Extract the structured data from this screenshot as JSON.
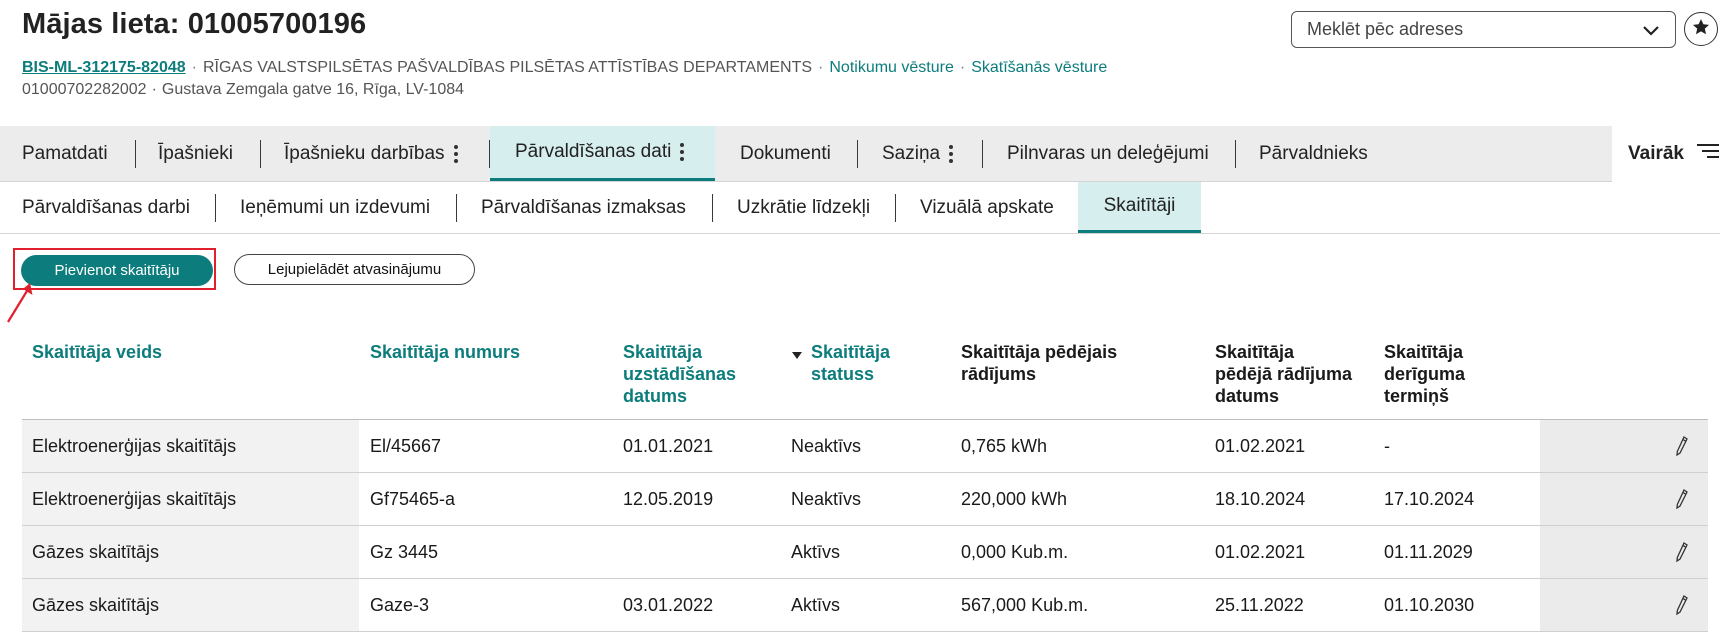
{
  "header": {
    "title": "Mājas lieta: 01005700196",
    "case_code": "BIS-ML-312175-82048",
    "department": "RĪGAS VALSTSPILSĒTAS PAŠVALDĪBAS PILSĒTAS ATTĪSTĪBAS DEPARTAMENTS",
    "separator": "·",
    "event_history_link": "Notikumu vēsture",
    "view_history_link": "Skatīšanās vēsture",
    "cadastre_number": "01000702282002",
    "address": "Gustava Zemgala gatve 16, Rīga, LV-1084"
  },
  "search": {
    "placeholder": "Meklēt pēc adreses",
    "icon": "chevron-down-icon"
  },
  "favorite_icon": "star-icon",
  "main_tabs": [
    {
      "label": "Pamatdati",
      "has_menu": false
    },
    {
      "label": "Īpašnieki",
      "has_menu": false
    },
    {
      "label": "Īpašnieku darbības",
      "has_menu": true
    },
    {
      "label": "Pārvaldīšanas dati",
      "has_menu": true,
      "active": true
    },
    {
      "label": "Dokumenti",
      "has_menu": false
    },
    {
      "label": "Saziņa",
      "has_menu": true
    },
    {
      "label": "Pilnvaras un deleģējumi",
      "has_menu": false
    },
    {
      "label": "Pārvaldnieks",
      "has_menu": false
    }
  ],
  "more_label": "Vairāk",
  "sub_tabs": [
    {
      "label": "Pārvaldīšanas darbi"
    },
    {
      "label": "Ieņēmumi un izdevumi"
    },
    {
      "label": "Pārvaldīšanas izmaksas"
    },
    {
      "label": "Uzkrātie līdzekļi"
    },
    {
      "label": "Vizuālā apskate"
    },
    {
      "label": "Skaitītāji",
      "active": true
    }
  ],
  "actions": {
    "add_meter": "Pievienot skaitītāju",
    "download_report": "Lejupielādēt atvasinājumu"
  },
  "table": {
    "columns": [
      {
        "l1": "Skaitītāja veids",
        "l2": "",
        "l3": ""
      },
      {
        "l1": "Skaitītāja numurs",
        "l2": "",
        "l3": ""
      },
      {
        "l1": "Skaitītāja",
        "l2": "uzstādīšanas",
        "l3": "datums"
      },
      {
        "l1": "Skaitītāja",
        "l2": "statuss",
        "l3": ""
      },
      {
        "l1": "Skaitītāja pēdējais",
        "l2": "rādījums",
        "l3": ""
      },
      {
        "l1": "Skaitītāja",
        "l2": "pēdējā rādījuma",
        "l3": "datums"
      },
      {
        "l1": "Skaitītāja",
        "l2": "derīguma",
        "l3": "termiņš"
      }
    ],
    "rows": [
      {
        "type": "Elektroenerģijas skaitītājs",
        "number": "El/45667",
        "installed": "01.01.2021",
        "status": "Neaktīvs",
        "last_reading": "0,765 kWh",
        "last_reading_date": "01.02.2021",
        "valid_until": "-"
      },
      {
        "type": "Elektroenerģijas skaitītājs",
        "number": "Gf75465-a",
        "installed": "12.05.2019",
        "status": "Neaktīvs",
        "last_reading": "220,000 kWh",
        "last_reading_date": "18.10.2024",
        "valid_until": "17.10.2024"
      },
      {
        "type": "Gāzes skaitītājs",
        "number": "Gz 3445",
        "installed": "",
        "status": "Aktīvs",
        "last_reading": "0,000 Kub.m.",
        "last_reading_date": "01.02.2021",
        "valid_until": "01.11.2029"
      },
      {
        "type": "Gāzes skaitītājs",
        "number": "Gaze-3",
        "installed": "03.01.2022",
        "status": "Aktīvs",
        "last_reading": "567,000 Kub.m.",
        "last_reading_date": "25.11.2022",
        "valid_until": "01.10.2030"
      }
    ],
    "row_action_icon": "pencil-icon"
  },
  "colors": {
    "accent": "#0c7d7c",
    "active_tab_bg": "#d6eeee",
    "highlight": "#e0202e"
  }
}
